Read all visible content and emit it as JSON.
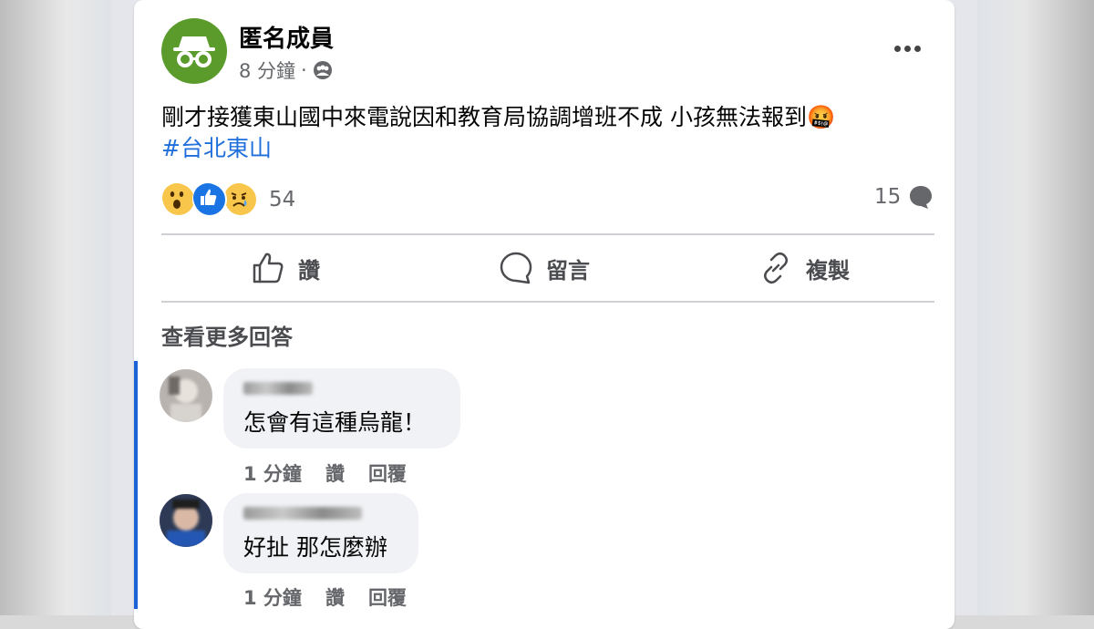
{
  "post": {
    "author": "匿名成員",
    "time": "8 分鐘",
    "separator": "·",
    "text": "剛才接獲東山國中來電說因和教育局協調增班不成 小孩無法報到🤬",
    "hashtag": "#台北東山",
    "reaction_count": "54",
    "comment_count": "15"
  },
  "actions": {
    "like": "讚",
    "comment": "留言",
    "copy": "複製"
  },
  "view_more": "查看更多回答",
  "comments": [
    {
      "text": "怎會有這種烏龍！",
      "time": "1 分鐘",
      "like": "讚",
      "reply": "回覆"
    },
    {
      "text": "好扯 那怎麼辦",
      "time": "1 分鐘",
      "like": "讚",
      "reply": "回覆"
    }
  ],
  "colors": {
    "link": "#216fdb",
    "thread_line": "#1b62d6",
    "avatar_bg": "#5a9b2c"
  }
}
